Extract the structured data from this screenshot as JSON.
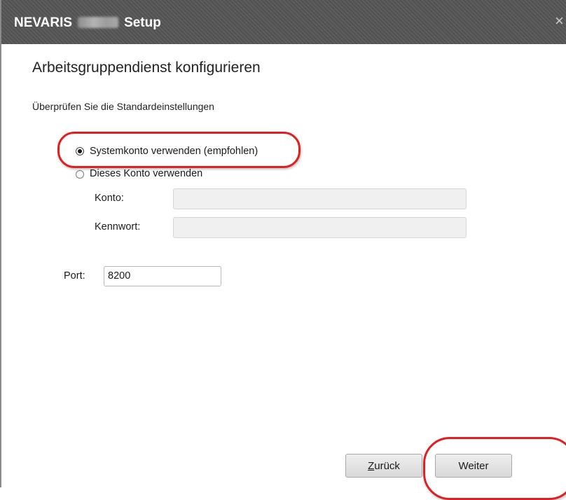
{
  "window": {
    "title_prefix": "NEVARIS",
    "title_suffix": "Setup",
    "close_glyph": "×"
  },
  "page": {
    "heading": "Arbeitsgruppendienst konfigurieren",
    "subheading": "Überprüfen Sie die Standardeinstellungen"
  },
  "account": {
    "option_system": "Systemkonto verwenden (empfohlen)",
    "option_custom": "Dieses Konto verwenden",
    "selected": "system",
    "konto_label": "Konto:",
    "konto_value": "",
    "kennwort_label": "Kennwort:",
    "kennwort_value": ""
  },
  "port": {
    "label": "Port:",
    "value": "8200"
  },
  "buttons": {
    "back_mnemonic": "Z",
    "back_rest": "urück",
    "next_label": "Weiter"
  },
  "colors": {
    "titlebar": "#555555",
    "annotation": "#e02020",
    "disabled_field": "#f0f0f0"
  }
}
